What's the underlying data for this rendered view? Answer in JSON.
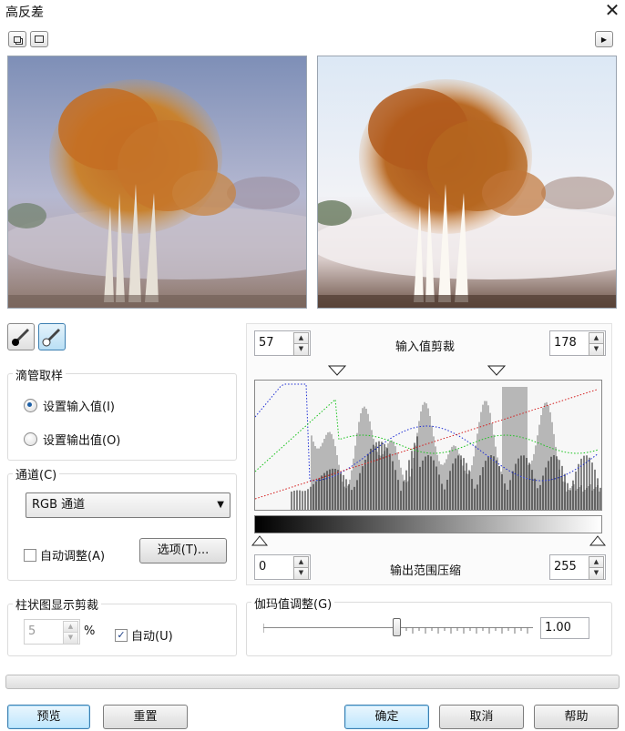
{
  "window": {
    "title": "高反差"
  },
  "colors": {
    "accent": "#1d5fa6",
    "histogram_bg": "#f5f5f5",
    "default_button": "#bee6fd"
  },
  "icons": {
    "close": "close-icon",
    "eyedropper_input": "eyedropper-black-icon",
    "eyedropper_output": "eyedropper-white-icon",
    "expand": "arrow-right-icon",
    "dual_view": "dual-preview-icon",
    "single_view": "single-preview-icon"
  },
  "eyedropper": {
    "group_label": "滴管取样",
    "options": [
      {
        "label": "设置输入值(I)",
        "selected": true
      },
      {
        "label": "设置输出值(O)",
        "selected": false
      }
    ]
  },
  "channel": {
    "group_label": "通道(C)",
    "selected": "RGB 通道",
    "auto_adjust_label": "自动调整(A)",
    "auto_adjust_checked": false,
    "options_button": "选项(T)..."
  },
  "histogram_clip": {
    "group_label": "柱状图显示剪裁",
    "value": "5",
    "unit": "%",
    "auto_label": "自动(U)",
    "auto_checked": true
  },
  "input_clip": {
    "label": "输入值剪裁",
    "low": "57",
    "high": "178"
  },
  "output_range": {
    "label": "输出范围压缩",
    "low": "0",
    "high": "255"
  },
  "gamma": {
    "group_label": "伽玛值调整(G)",
    "value": "1.00"
  },
  "buttons": {
    "preview": "预览",
    "reset": "重置",
    "ok": "确定",
    "cancel": "取消",
    "help": "帮助"
  }
}
